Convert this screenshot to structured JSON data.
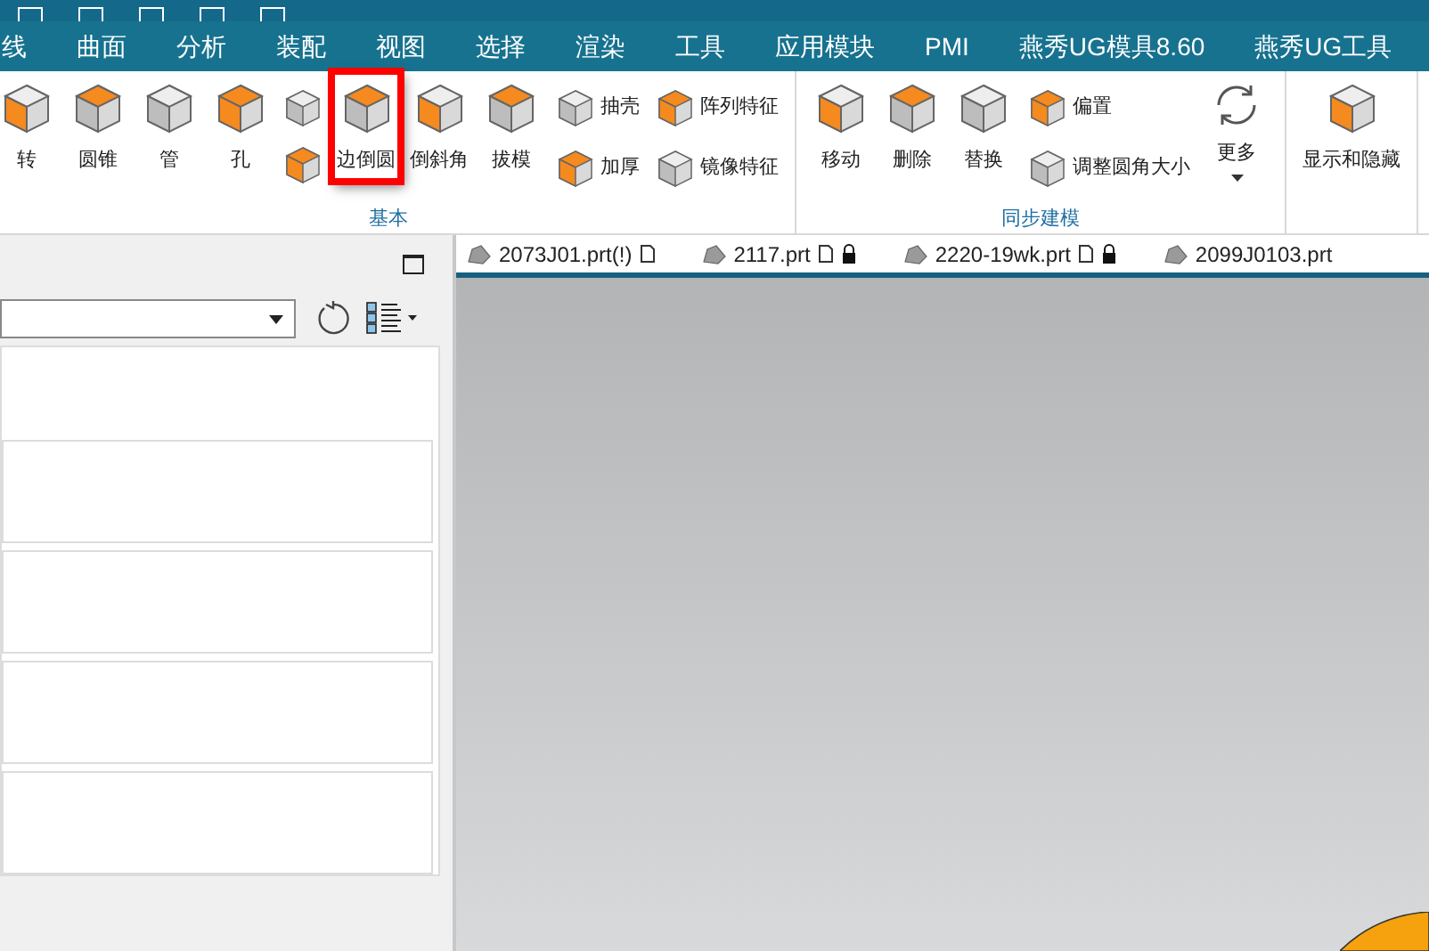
{
  "menu": [
    {
      "label": "线"
    },
    {
      "label": "曲面"
    },
    {
      "label": "分析"
    },
    {
      "label": "装配"
    },
    {
      "label": "视图"
    },
    {
      "label": "选择"
    },
    {
      "label": "渲染"
    },
    {
      "label": "工具"
    },
    {
      "label": "应用模块"
    },
    {
      "label": "PMI"
    },
    {
      "label": "燕秀UG模具8.60"
    },
    {
      "label": "燕秀UG工具"
    }
  ],
  "ribbon_groups": [
    {
      "label": "基本",
      "tools": [
        {
          "kind": "large",
          "label": "转",
          "highlighted": false
        },
        {
          "kind": "large",
          "label": "圆锥",
          "highlighted": false
        },
        {
          "kind": "large",
          "label": "管",
          "highlighted": false
        },
        {
          "kind": "large",
          "label": "孔",
          "highlighted": false
        },
        {
          "kind": "stack",
          "highlighted": false
        },
        {
          "kind": "large",
          "label": "边倒圆",
          "highlighted": true
        },
        {
          "kind": "large",
          "label": "倒斜角",
          "highlighted": false
        },
        {
          "kind": "large",
          "label": "拔模",
          "highlighted": false
        },
        {
          "kind": "pair",
          "labels": [
            "抽壳",
            "加厚"
          ],
          "highlighted": false
        },
        {
          "kind": "pair",
          "labels": [
            "阵列特征",
            "镜像特征"
          ],
          "highlighted": false
        }
      ]
    },
    {
      "label": "同步建模",
      "tools": [
        {
          "kind": "large",
          "label": "移动",
          "highlighted": false
        },
        {
          "kind": "large",
          "label": "删除",
          "highlighted": false
        },
        {
          "kind": "large",
          "label": "替换",
          "highlighted": false
        },
        {
          "kind": "pair",
          "labels": [
            "偏置",
            "调整圆角大小"
          ],
          "highlighted": false
        },
        {
          "kind": "more",
          "label": "更多",
          "highlighted": false
        }
      ]
    },
    {
      "tools": [
        {
          "kind": "large",
          "label": "显示和隐藏",
          "highlighted": false
        }
      ]
    }
  ],
  "file_tabs": [
    {
      "label": "2073J01.prt(!)",
      "locked": false
    },
    {
      "label": "2117.prt",
      "locked": true
    },
    {
      "label": "2220-19wk.prt",
      "locked": true
    },
    {
      "label": "2099J0103.prt",
      "locked": false
    }
  ]
}
